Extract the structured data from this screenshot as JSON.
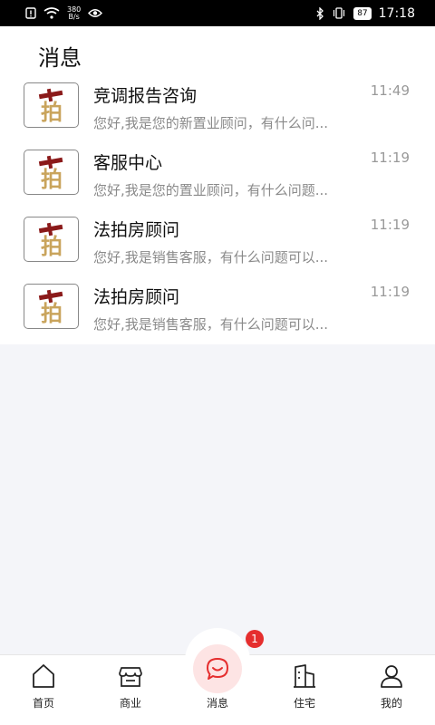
{
  "status_bar": {
    "speed_value": "380",
    "speed_unit": "B/s",
    "battery": "87",
    "time": "17:18"
  },
  "header": {
    "title": "消息"
  },
  "messages": [
    {
      "name": "竞调报告咨询",
      "time": "11:49",
      "preview": "您好,我是您的新置业顾问，有什么问..."
    },
    {
      "name": "客服中心",
      "time": "11:19",
      "preview": "您好,我是您的置业顾问，有什么问题..."
    },
    {
      "name": "法拍房顾问",
      "time": "11:19",
      "preview": "您好,我是销售客服，有什么问题可以..."
    },
    {
      "name": "法拍房顾问",
      "time": "11:19",
      "preview": "您好,我是销售客服，有什么问题可以..."
    }
  ],
  "avatar_glyph": "拍",
  "bottom_nav": {
    "items": [
      {
        "label": "首页",
        "icon": "home-icon"
      },
      {
        "label": "商业",
        "icon": "store-icon"
      },
      {
        "label": "消息",
        "icon": "chat-icon",
        "badge": "1"
      },
      {
        "label": "住宅",
        "icon": "building-icon"
      },
      {
        "label": "我的",
        "icon": "user-icon"
      }
    ]
  },
  "colors": {
    "accent": "#e52e2e",
    "accent_bg": "#fde4e4",
    "avatar_gold": "#c9a45c",
    "avatar_red": "#8b1a1a"
  }
}
